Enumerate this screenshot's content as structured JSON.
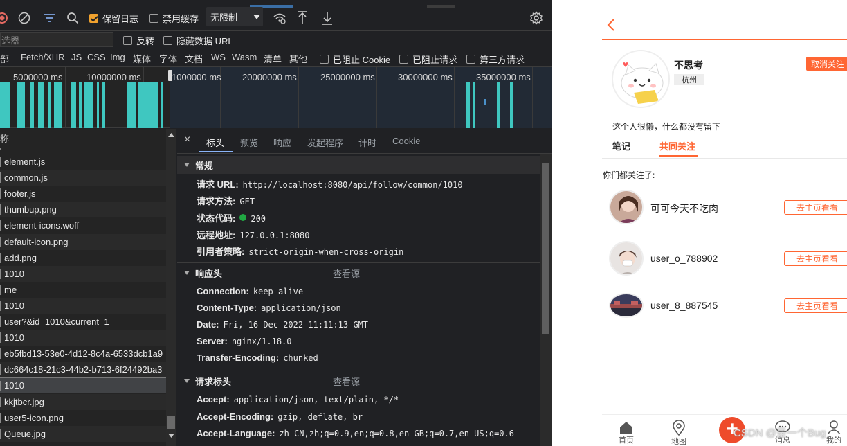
{
  "devtools": {
    "toolbar": {
      "preserve_log": "保留日志",
      "disable_cache": "禁用缓存",
      "throttle": "无限制"
    },
    "filter": {
      "placeholder": "过滤器",
      "visible_text": "选器",
      "invert": "反转",
      "hide_data_urls": "隐藏数据 URL"
    },
    "types": {
      "all_partial": "部",
      "items": [
        "Fetch/XHR",
        "JS",
        "CSS",
        "Img",
        "媒体",
        "字体",
        "文档",
        "WS",
        "Wasm",
        "清单",
        "其他"
      ],
      "blocked_cookies": "已阻止 Cookie",
      "blocked_requests": "已阻止请求",
      "third_party": "第三方请求"
    },
    "timeline": {
      "ticks": [
        "5000000 ms",
        "10000000 ms",
        "1000000 ms",
        "20000000 ms",
        "25000000 ms",
        "30000000 ms",
        "35000000 ms"
      ]
    },
    "request_list": {
      "header": "称",
      "items": [
        "element.js",
        "common.js",
        "footer.js",
        "thumbup.png",
        "element-icons.woff",
        "default-icon.png",
        "add.png",
        "1010",
        "me",
        "1010",
        "user?&id=1010&current=1",
        "1010",
        "eb5fbd13-53e0-4d12-8c4a-6533dcb1a9",
        "dc664c18-21c3-44b2-b713-6f24492ba3",
        "1010",
        "kkjtbcr.jpg",
        "user5-icon.png",
        "Queue.jpg"
      ],
      "selected_index": 14
    },
    "headers_tabs": [
      "标头",
      "预览",
      "响应",
      "发起程序",
      "计时",
      "Cookie"
    ],
    "general": {
      "title": "常规",
      "rows": [
        {
          "k": "请求 URL:",
          "v": "http://localhost:8080/api/follow/common/1010"
        },
        {
          "k": "请求方法:",
          "v": "GET"
        },
        {
          "k": "状态代码:",
          "v": "200"
        },
        {
          "k": "远程地址:",
          "v": "127.0.0.1:8080"
        },
        {
          "k": "引用者策略:",
          "v": "strict-origin-when-cross-origin"
        }
      ]
    },
    "response_headers": {
      "title": "响应头",
      "view_source": "查看源",
      "rows": [
        {
          "k": "Connection:",
          "v": "keep-alive"
        },
        {
          "k": "Content-Type:",
          "v": "application/json"
        },
        {
          "k": "Date:",
          "v": "Fri, 16 Dec 2022 11:11:13 GMT"
        },
        {
          "k": "Server:",
          "v": "nginx/1.18.0"
        },
        {
          "k": "Transfer-Encoding:",
          "v": "chunked"
        }
      ]
    },
    "request_headers": {
      "title": "请求标头",
      "view_source": "查看源",
      "rows": [
        {
          "k": "Accept:",
          "v": "application/json, text/plain, */*"
        },
        {
          "k": "Accept-Encoding:",
          "v": "gzip, deflate, br"
        },
        {
          "k": "Accept-Language:",
          "v": "zh-CN,zh;q=0.9,en;q=0.8,en-GB;q=0.7,en-US;q=0.6"
        }
      ]
    }
  },
  "app": {
    "user_name": "不思考",
    "city": "杭州",
    "unfollow": "取消关注",
    "bio": "这个人很懒，什么都没有留下",
    "tabs": [
      "笔记",
      "共同关注"
    ],
    "common_label": "你们都关注了:",
    "follows": [
      {
        "name": "可可今天不吃肉",
        "button": "去主页看看"
      },
      {
        "name": "user_o_788902",
        "button": "去主页看看"
      },
      {
        "name": "user_8_887545",
        "button": "去主页看看"
      }
    ],
    "bottom_nav": [
      "首页",
      "地图",
      "消息",
      "我的"
    ],
    "accent": "#ff6633"
  },
  "watermark": "CSDN @是一个Bug"
}
